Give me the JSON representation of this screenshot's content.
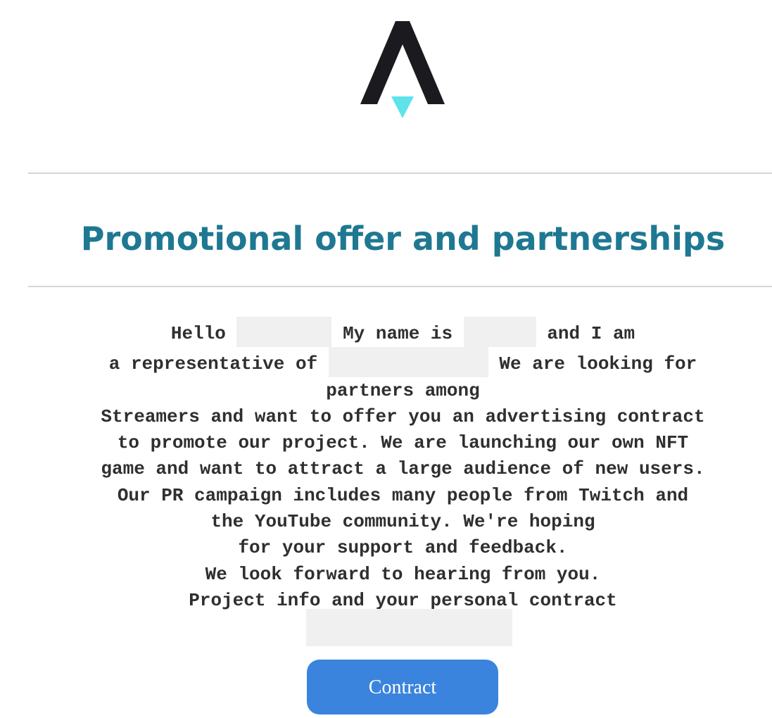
{
  "email": {
    "logo_icon": "arrow-up-logo-icon",
    "title": "Promotional offer and partnerships",
    "greeting_hello": "Hello",
    "my_name_is": "My name is",
    "and_i_am": "and I am",
    "representative_of": "a representative of",
    "looking_for": "We are looking for",
    "partners_among": "partners among",
    "body_lines": [
      "Streamers and want to offer you an advertising contract",
      "to promote our project. We are launching our own NFT",
      "game and want to attract a large audience of new users.",
      "Our PR campaign includes many people from Twitch and",
      "the YouTube community. We're hoping",
      "for your support and feedback.",
      "We look forward to hearing from you.",
      "Project info and your personal contract"
    ],
    "button_label": "Contract",
    "colors": {
      "title": "#1f7892",
      "logo_dark": "#1b1b1f",
      "logo_accent": "#5ee3ea",
      "button": "#3a84dd",
      "redaction": "#f0f0f0"
    }
  }
}
